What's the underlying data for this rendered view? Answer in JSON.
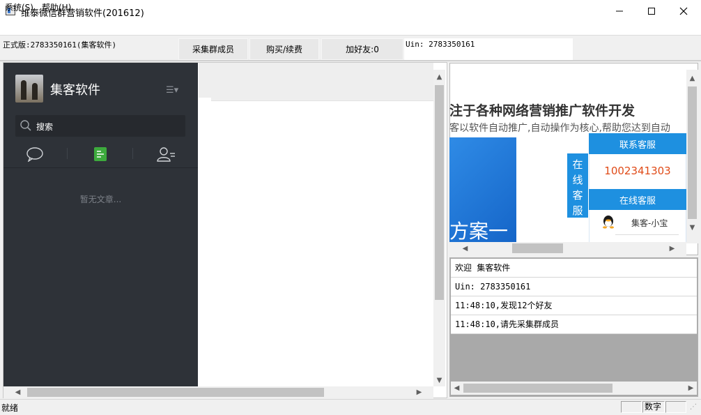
{
  "window": {
    "title": "维泰微信群营销软件(201612)"
  },
  "menu": {
    "system": "系统(S)",
    "help": "帮助(H)"
  },
  "toolbar": {
    "edition": "正式版:2783350161(集客软件)",
    "collect_label": "采集群成员",
    "buy_label": "购买/续费",
    "add_friend_label": "加好友:0",
    "uin_label": "Uin: 2783350161"
  },
  "wechat": {
    "nickname": "集客软件",
    "search_placeholder": "搜索",
    "empty_text": "暂无文章..."
  },
  "web": {
    "headline": "注于各种网络营销推广软件开发",
    "subline": "客以软件自动推广,自动操作为核心,帮助您达到自动",
    "banner_text": "方案一",
    "side_tab": "在线客服",
    "contact_title": "联系客服",
    "phone": "1002341303",
    "online_title": "在线客服",
    "qq_name": "集客-小宝"
  },
  "log": [
    "欢迎 集客软件",
    "Uin: 2783350161",
    "11:48:10,发现12个好友",
    "11:48:10,请先采集群成员"
  ],
  "status": {
    "text": "就绪",
    "numlock": "数字"
  },
  "colors": {
    "sidebar": "#2e3238",
    "accent": "#1e90e0",
    "phone": "#e04b18",
    "wechat_green": "#3daa3d"
  }
}
